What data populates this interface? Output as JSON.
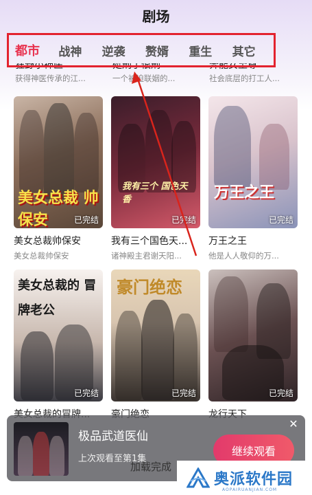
{
  "header": {
    "title": "剧场"
  },
  "tabs": [
    {
      "label": "都市",
      "active": true
    },
    {
      "label": "战神",
      "active": false
    },
    {
      "label": "逆袭",
      "active": false
    },
    {
      "label": "赘婿",
      "active": false
    },
    {
      "label": "重生",
      "active": false
    },
    {
      "label": "其它",
      "active": false
    }
  ],
  "partial_row": [
    {
      "title": "狂野小神医",
      "subtitle": "获得神医传承的江..."
    },
    {
      "title": "処刑了恨刑",
      "subtitle": "一个被迫联姻的..."
    },
    {
      "title": "奔能女至尊",
      "subtitle": "社会底层的打工人..."
    }
  ],
  "cards": [
    {
      "title": "美女总裁帅保安",
      "subtitle": "美女总裁帅保安",
      "status": "已完结",
      "overlay": "美女总裁 帅保安"
    },
    {
      "title": "我有三个国色天...",
      "subtitle": "诸神殿主君谢天阳...",
      "status": "已完结",
      "overlay": "我有三个 国色天香"
    },
    {
      "title": "万王之王",
      "subtitle": "他是人人敬仰的万...",
      "status": "已完结",
      "overlay": "万王之王"
    },
    {
      "title": "美女总裁的冒牌...",
      "subtitle": "",
      "status": "已完结",
      "overlay": "美女总裁的 冒牌老公"
    },
    {
      "title": "豪门绝恋",
      "subtitle": "",
      "status": "已完结",
      "overlay": "豪门绝恋"
    },
    {
      "title": "龙行天下",
      "subtitle": "",
      "status": "已完结",
      "overlay": ""
    }
  ],
  "popup": {
    "title": "极品武道医仙",
    "subtitle": "上次观看至第1集",
    "continue_label": "继续观看",
    "close_label": "✕"
  },
  "loading_text": "加载完成",
  "watermark": {
    "text": "奥派软件园",
    "small": "AOPAIRUANJIAN.COM"
  },
  "colors": {
    "accent": "#e8314e",
    "highlight": "#e3222e",
    "watermark": "#2b78c8"
  }
}
